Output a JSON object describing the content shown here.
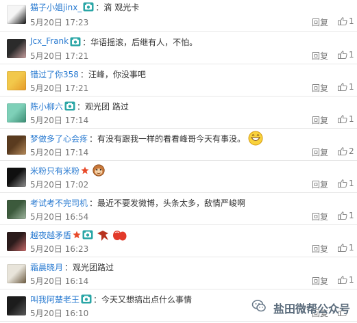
{
  "comments": [
    {
      "name": "猫子小姐jinx_",
      "badges": [
        "vip"
      ],
      "sep": "：",
      "text": "滴  观光卡",
      "time": "5月20日 17:23",
      "reply": "回复",
      "likes": "1",
      "avatar_colors": [
        "#f5f5f5",
        "#111111"
      ]
    },
    {
      "name": "Jcx_Frank",
      "badges": [
        "vip"
      ],
      "sep": "：",
      "text": "华语摇滚，后继有人，不怕。",
      "time": "5月20日 17:21",
      "reply": "回复",
      "likes": "1",
      "avatar_colors": [
        "#2b2b2b",
        "#c8a0a0"
      ]
    },
    {
      "name": "错过了你358",
      "badges": [],
      "sep": "：",
      "text": "汪峰，你没事吧",
      "time": "5月20日 17:21",
      "reply": "回复",
      "likes": "1",
      "avatar_colors": [
        "#f2c84b",
        "#e69a28"
      ]
    },
    {
      "name": "陈小柳六",
      "badges": [
        "vip"
      ],
      "sep": "：",
      "text": "观光团 路过",
      "time": "5月20日 17:14",
      "reply": "回复",
      "likes": "1",
      "avatar_colors": [
        "#7ed0b8",
        "#3b8c73"
      ]
    },
    {
      "name": "梦做多了心会疼",
      "badges": [],
      "sep": "：",
      "text": "有没有跟我一样的看看峰哥今天有事没。",
      "time": "5月20日 17:14",
      "reply": "回复",
      "likes": "2",
      "avatar_colors": [
        "#5a3b1f",
        "#b58a5a"
      ],
      "emoji": "grin"
    },
    {
      "name": "米粉只有米粉",
      "badges": [
        "star"
      ],
      "sep": "",
      "text": "",
      "time": "5月20日 17:02",
      "reply": "回复",
      "likes": "1",
      "avatar_colors": [
        "#101010",
        "#8f8f8f"
      ],
      "emoji": "monkey"
    },
    {
      "name": "考试考不完司机",
      "badges": [],
      "sep": "：",
      "text": "最近不要发微博，头条太多，敌情严峻啊",
      "time": "5月20日 16:54",
      "reply": "回复",
      "likes": "1",
      "avatar_colors": [
        "#3c5a3c",
        "#9fb59f"
      ]
    },
    {
      "name": "越夜越矛盾",
      "badges": [
        "star",
        "vip"
      ],
      "sep": "",
      "text": "",
      "time": "5月20日 16:23",
      "reply": "回复",
      "likes": "1",
      "avatar_colors": [
        "#2b1b1b",
        "#c86a6a"
      ],
      "emoji": "ribbon-hands"
    },
    {
      "name": "霜晨晓月",
      "badges": [],
      "sep": "：",
      "text": "观光团路过",
      "time": "5月20日 16:14",
      "reply": "回复",
      "likes": "1",
      "avatar_colors": [
        "#e8e4da",
        "#6b5a40"
      ]
    },
    {
      "name": "叫我阿楚老王",
      "badges": [
        "vip"
      ],
      "sep": "：",
      "text": "今天又想搞出点什么事情",
      "time": "5月20日 16:10",
      "reply": "回复",
      "likes": "",
      "avatar_colors": [
        "#1c1c1c",
        "#5a5a5a"
      ]
    }
  ],
  "watermark": {
    "text": "盐田微帮公众号",
    "icon": "wechat-icon"
  },
  "colors": {
    "name": "#2a7bd1",
    "meta": "#777777",
    "vip": "#2aa6a6",
    "star": "#e84a2a",
    "divider": "#e6e6e6"
  }
}
